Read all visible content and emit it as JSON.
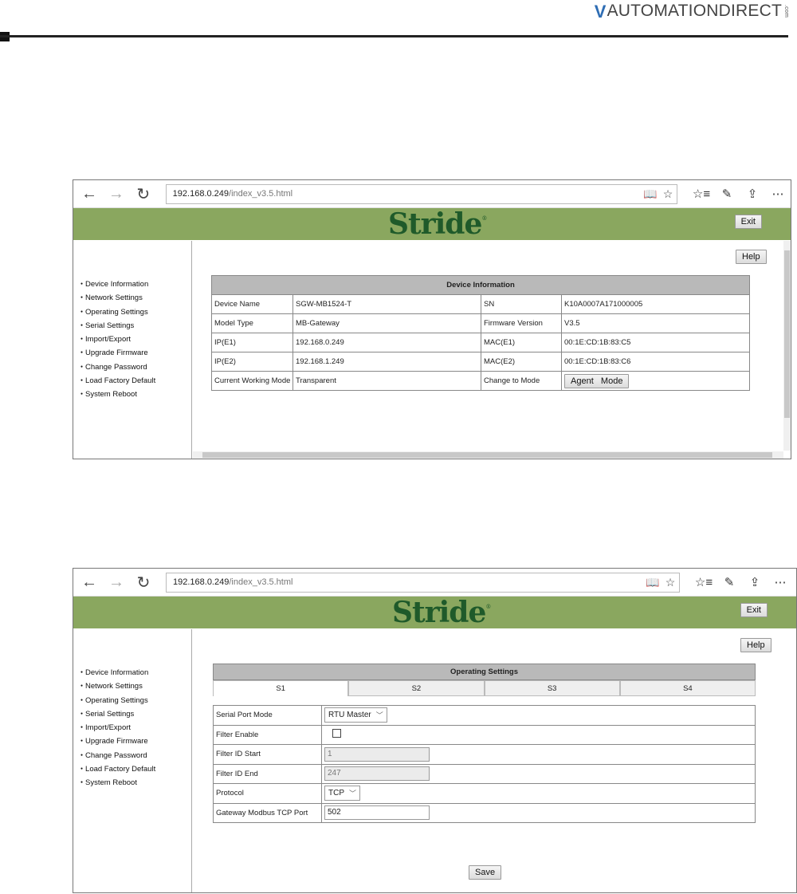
{
  "page_header": {
    "brand": "AUTOMATIONDIRECT",
    "brand_suffix": ".com"
  },
  "windows": [
    {
      "address": {
        "host": "192.168.0.249",
        "path": "/index_v3.5.html"
      },
      "banner": {
        "logo": "Stride",
        "exit_label": "Exit"
      },
      "sidebar": [
        "Device Information",
        "Network Settings",
        "Operating Settings",
        "Serial Settings",
        "Import/Export",
        "Upgrade Firmware",
        "Change Password",
        "Load Factory Default",
        "System Reboot"
      ],
      "help_label": "Help",
      "device_info": {
        "title": "Device Information",
        "rows": [
          [
            "Device Name",
            "SGW-MB1524-T",
            "SN",
            "K10A0007A171000005"
          ],
          [
            "Model Type",
            "MB-Gateway",
            "Firmware Version",
            "V3.5"
          ],
          [
            "IP(E1)",
            "192.168.0.249",
            "MAC(E1)",
            "00:1E:CD:1B:83:C5"
          ],
          [
            "IP(E2)",
            "192.168.1.249",
            "MAC(E2)",
            "00:1E:CD:1B:83:C6"
          ]
        ],
        "mode_row": {
          "label": "Current Working Mode",
          "value": "Transparent",
          "change_label": "Change to Mode",
          "button": "Agent   Mode"
        }
      }
    },
    {
      "address": {
        "host": "192.168.0.249",
        "path": "/index_v3.5.html"
      },
      "banner": {
        "logo": "Stride",
        "exit_label": "Exit"
      },
      "sidebar": [
        "Device Information",
        "Network Settings",
        "Operating Settings",
        "Serial Settings",
        "Import/Export",
        "Upgrade Firmware",
        "Change Password",
        "Load Factory Default",
        "System Reboot"
      ],
      "help_label": "Help",
      "operating": {
        "title": "Operating Settings",
        "tabs": [
          "S1",
          "S2",
          "S3",
          "S4"
        ],
        "serial_port_mode": {
          "label": "Serial Port Mode",
          "value": "RTU Master"
        },
        "filter_enable": {
          "label": "Filter Enable",
          "checked": false
        },
        "filter_id_start": {
          "label": "Filter ID Start",
          "value": "1"
        },
        "filter_id_end": {
          "label": "Filter ID End",
          "value": "247"
        },
        "protocol": {
          "label": "Protocol",
          "value": "TCP"
        },
        "tcp_port": {
          "label": "Gateway Modbus TCP Port",
          "value": "502"
        },
        "save_label": "Save"
      }
    }
  ]
}
